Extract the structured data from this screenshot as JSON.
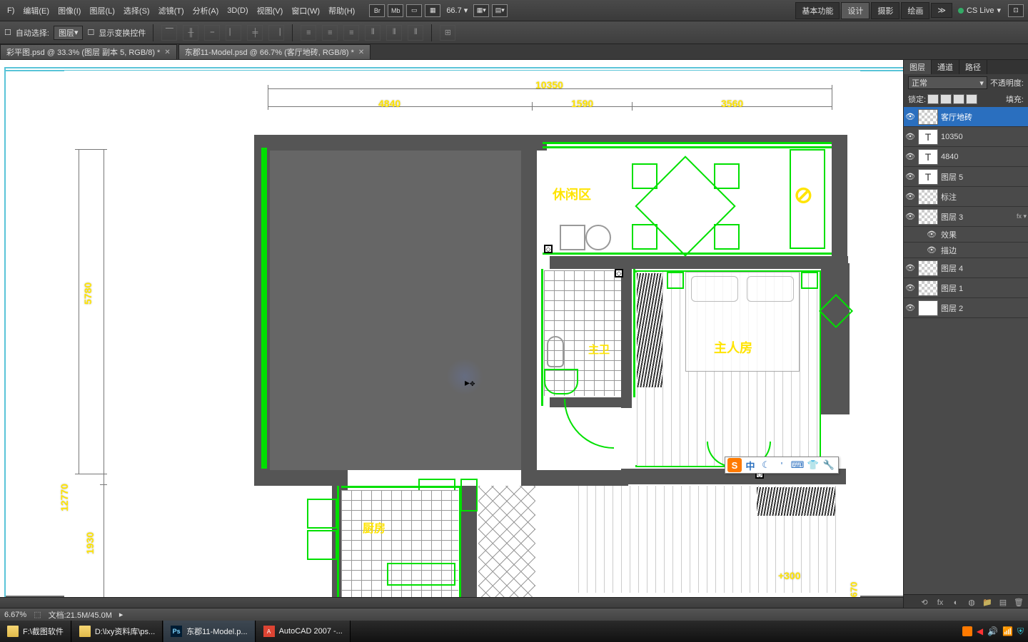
{
  "menu": {
    "file": "F)",
    "edit": "编辑(E)",
    "image": "图像(I)",
    "layer": "图层(L)",
    "select": "选择(S)",
    "filter": "滤镜(T)",
    "analysis": "分析(A)",
    "threed": "3D(D)",
    "view": "视图(V)",
    "window": "窗口(W)",
    "help": "帮助(H)",
    "zoom": "66.7",
    "ws_basic": "基本功能",
    "ws_design": "设计",
    "ws_photo": "摄影",
    "ws_paint": "绘画",
    "cslive": "CS Live"
  },
  "opts": {
    "auto_select_label": "自动选择:",
    "auto_select_value": "图层",
    "show_transform": "显示变换控件"
  },
  "tabs": {
    "t1": "彩平图.psd @ 33.3% (图层 副本 5, RGB/8) *",
    "t2": "东郡11-Model.psd @ 66.7% (客厅地砖, RGB/8) *"
  },
  "plan": {
    "dim_total": "10350",
    "dim_a": "4840",
    "dim_b": "1590",
    "dim_c": "3560",
    "dim_left": "5780",
    "dim_left2": "12770",
    "dim_left3": "1930",
    "dim_right": "670",
    "dim_bot": "+300",
    "room_rest": "休闲区",
    "room_bath": "主卫",
    "room_master": "主人房",
    "room_kitchen": "厨房"
  },
  "layers": {
    "tab_layer": "图层",
    "tab_channel": "通道",
    "tab_path": "路径",
    "blend": "正常",
    "opacity_label": "不透明度:",
    "lock_label": "锁定:",
    "fill_label": "填充:",
    "l0": "客厅地砖",
    "l1": "10350",
    "l2": "4840",
    "l3": "图层 5",
    "l4": "标注",
    "l5": "图层 3",
    "l5fx": "效果",
    "l5fx2": "描边",
    "l6": "图层 4",
    "l7": "图层 1",
    "l8": "图层 2"
  },
  "status": {
    "zoom": "6.67%",
    "docinfo": "文档:21.5M/45.0M"
  },
  "taskbar": {
    "t1": "F:\\截图软件",
    "t2": "D:\\lxy资料库\\ps...",
    "t3": "东郡11-Model.p...",
    "t4": "AutoCAD 2007 -..."
  },
  "ime": {
    "ch": "中"
  }
}
